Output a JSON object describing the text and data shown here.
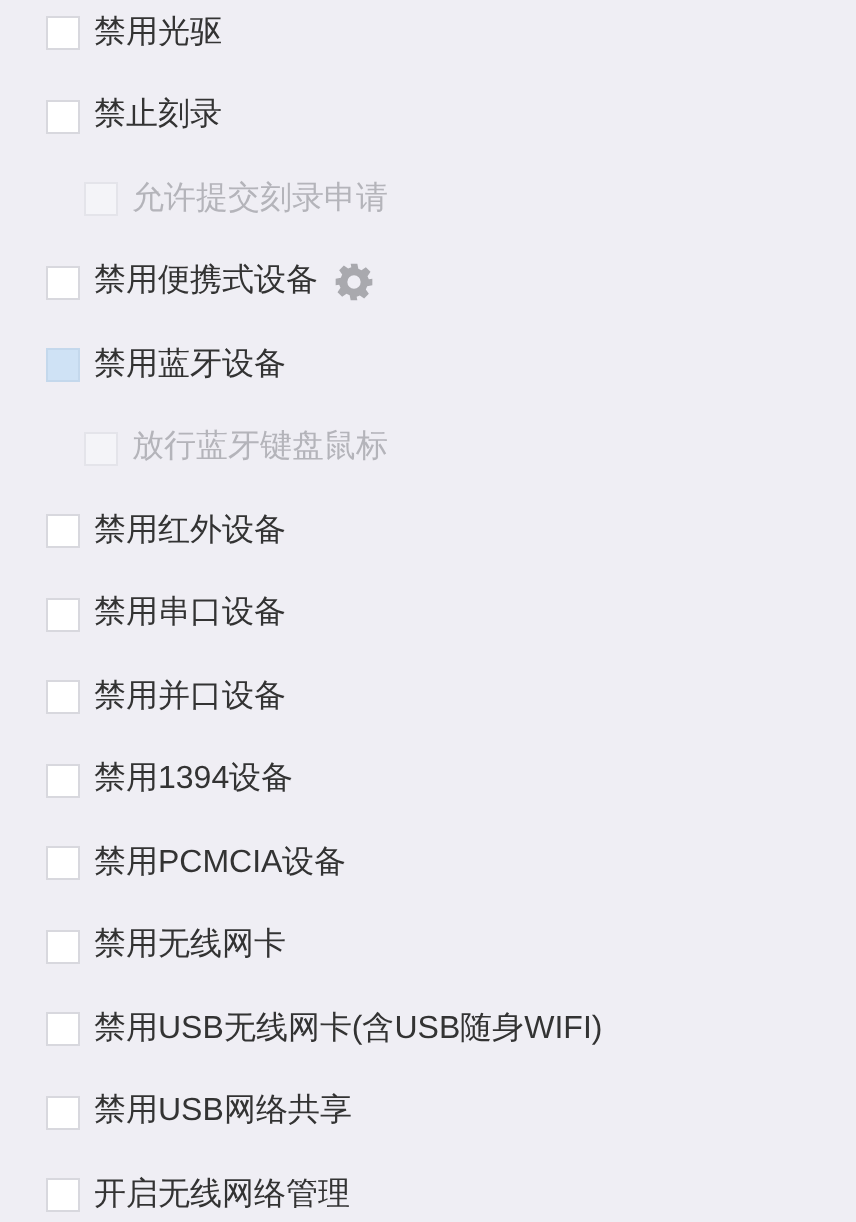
{
  "options": [
    {
      "label": "禁用光驱",
      "checked": false,
      "highlighted": false,
      "disabled": false
    },
    {
      "label": "禁止刻录",
      "checked": false,
      "highlighted": false,
      "disabled": false,
      "children": [
        {
          "label": "允许提交刻录申请",
          "checked": false,
          "disabled": true
        }
      ]
    },
    {
      "label": "禁用便携式设备",
      "checked": false,
      "highlighted": false,
      "disabled": false,
      "has_settings": true
    },
    {
      "label": "禁用蓝牙设备",
      "checked": false,
      "highlighted": true,
      "disabled": false,
      "children": [
        {
          "label": "放行蓝牙键盘鼠标",
          "checked": false,
          "disabled": true
        }
      ]
    },
    {
      "label": "禁用红外设备",
      "checked": false,
      "highlighted": false,
      "disabled": false
    },
    {
      "label": "禁用串口设备",
      "checked": false,
      "highlighted": false,
      "disabled": false
    },
    {
      "label": "禁用并口设备",
      "checked": false,
      "highlighted": false,
      "disabled": false
    },
    {
      "label": "禁用1394设备",
      "checked": false,
      "highlighted": false,
      "disabled": false
    },
    {
      "label": "禁用PCMCIA设备",
      "checked": false,
      "highlighted": false,
      "disabled": false
    },
    {
      "label": "禁用无线网卡",
      "checked": false,
      "highlighted": false,
      "disabled": false
    },
    {
      "label": "禁用USB无线网卡(含USB随身WIFI)",
      "checked": false,
      "highlighted": false,
      "disabled": false
    },
    {
      "label": "禁用USB网络共享",
      "checked": false,
      "highlighted": false,
      "disabled": false
    },
    {
      "label": "开启无线网络管理",
      "checked": false,
      "highlighted": false,
      "disabled": false
    }
  ]
}
